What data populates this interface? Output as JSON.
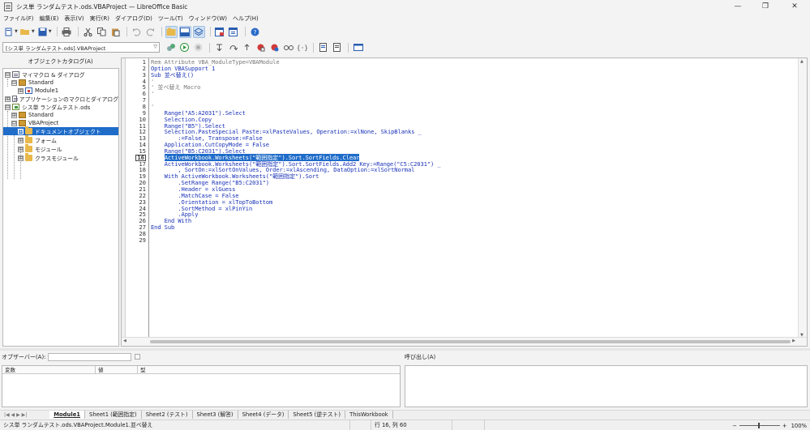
{
  "window": {
    "title": "シス単 ランダムテスト.ods.VBAProject — LibreOffice Basic",
    "minimize_glyph": "—",
    "maximize_glyph": "❐",
    "close_glyph": "✕"
  },
  "menu": [
    "ファイル(F)",
    "編集(E)",
    "表示(V)",
    "実行(R)",
    "ダイアログ(D)",
    "ツール(T)",
    "ウィンドウ(W)",
    "ヘルプ(H)"
  ],
  "library_select": {
    "value": "[シス単 ランダムテスト.ods].VBAProject"
  },
  "catalog": {
    "title": "オブジェクトカタログ(A)",
    "items": [
      {
        "label": "マイマクロ & ダイアログ",
        "expander": "⊟"
      },
      {
        "label": "Standard",
        "expander": "⊟"
      },
      {
        "label": "Module1",
        "expander": "⊞"
      },
      {
        "label": "アプリケーションのマクロとダイアログ",
        "expander": "⊞"
      },
      {
        "label": "シス単 ランダムテスト.ods",
        "expander": "⊟"
      },
      {
        "label": "Standard",
        "expander": "⊞"
      },
      {
        "label": "VBAProject",
        "expander": "⊟"
      },
      {
        "label": "ドキュメントオブジェクト",
        "expander": "⊞"
      },
      {
        "label": "フォーム",
        "expander": "⊞"
      },
      {
        "label": "モジュール",
        "expander": "⊞"
      },
      {
        "label": "クラスモジュール",
        "expander": "⊞"
      }
    ]
  },
  "editor": {
    "line_numbers": [
      "1",
      "2",
      "3",
      "4",
      "5",
      "6",
      "7",
      "8",
      "9",
      "10",
      "11",
      "12",
      "13",
      "14",
      "15",
      "16",
      "17",
      "18",
      "19",
      "20",
      "21",
      "22",
      "23",
      "24",
      "25",
      "26",
      "27",
      "28",
      "29"
    ],
    "lines": [
      "Rem Attribute VBA_ModuleType=VBAModule",
      "Option VBASupport 1",
      "Sub 並べ替え()",
      "'",
      "' 並べ替え Macro",
      "'",
      "",
      "'",
      "    Range(\"A5:A2031\").Select",
      "    Selection.Copy",
      "    Range(\"B5\").Select",
      "    Selection.PasteSpecial Paste:=xlPasteValues, Operation:=xlNone, SkipBlanks _",
      "        :=False, Transpose:=False",
      "    Application.CutCopyMode = False",
      "    Range(\"B5:C2031\").Select",
      "    ActiveWorkbook.Worksheets(\"範囲指定\").Sort.SortFields.Clear",
      "    ActiveWorkbook.Worksheets(\"範囲指定\").Sort.SortFields.Add2 Key:=Range(\"C5:C2031\") _",
      "        , SortOn:=xlSortOnValues, Order:=xlAscending, DataOption:=xlSortNormal",
      "    With ActiveWorkbook.Worksheets(\"範囲指定\").Sort",
      "        .SetRange Range(\"B5:C2031\")",
      "        .Header = xlGuess",
      "        .MatchCase = False",
      "        .Orientation = xlTopToBottom",
      "        .SortMethod = xlPinYin",
      "        .Apply",
      "    End With",
      "End Sub",
      "",
      ""
    ],
    "current_line": 16
  },
  "observer": {
    "label": "オブザーバー(A):",
    "columns": [
      "変数",
      "値",
      "型"
    ]
  },
  "callstack": {
    "label": "呼び出し(A)"
  },
  "tabs": [
    "Module1",
    "Sheet1 (範囲指定)",
    "Sheet2 (テスト)",
    "Sheet3 (解答)",
    "Sheet4 (データ)",
    "Sheet5 (逆テスト)",
    "ThisWorkbook"
  ],
  "tab_nav": "|◀ ◀ ▶ ▶|",
  "status": {
    "path": "シス単 ランダムテスト.ods.VBAProject.Module1.並べ替え",
    "position": "行 16, 列 60",
    "zoom": "100%",
    "zoom_minus": "−",
    "zoom_plus": "+"
  }
}
